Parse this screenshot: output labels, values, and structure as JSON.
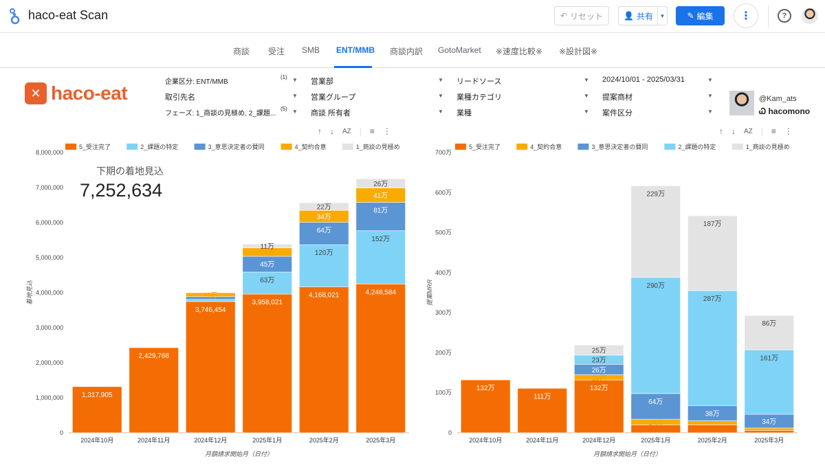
{
  "app": {
    "title": "haco-eat Scan",
    "reset_label": "リセット",
    "share_label": "共有",
    "edit_label": "編集"
  },
  "tabs": [
    {
      "label": "商談"
    },
    {
      "label": "受注"
    },
    {
      "label": "SMB"
    },
    {
      "label": "ENT/MMB",
      "active": true
    },
    {
      "label": "商談内訳"
    },
    {
      "label": "GotoMarket"
    },
    {
      "label": "※速度比較※"
    },
    {
      "label": "※設計図※"
    }
  ],
  "brand": {
    "name": "haco-eat"
  },
  "filters": {
    "row1": [
      {
        "label": "企業区分: ENT/MMB",
        "count": "(1)"
      },
      {
        "label": "営業部"
      },
      {
        "label": "リードソース"
      },
      {
        "label": "2024/10/01 - 2025/03/31"
      }
    ],
    "row2": [
      {
        "label": "取引先名"
      },
      {
        "label": "営業グループ"
      },
      {
        "label": "業種カテゴリ"
      },
      {
        "label": "提案商材"
      }
    ],
    "row3": [
      {
        "label": "フェーズ: 1_商談の見極め, 2_課題...",
        "count": "(5)"
      },
      {
        "label": "商談 所有者"
      },
      {
        "label": "業種"
      },
      {
        "label": "案件区分"
      }
    ]
  },
  "profile": {
    "handle": "@Kam_ats",
    "company": "hacomono"
  },
  "colors": {
    "phase5": "#f46d04",
    "phase4": "#f9ab00",
    "phase3": "#5b95d4",
    "phase2": "#7fd3f7",
    "phase1": "#e3e3e3",
    "accent": "#1a73e8"
  },
  "chart_data": [
    {
      "type": "bar",
      "stacked": true,
      "kpi_label": "下期の着地見込",
      "kpi_value": "7,252,634",
      "xlabel": "月額請求開始月（日付）",
      "ylabel": "着地見込",
      "ylim": [
        0,
        8000000
      ],
      "yticks": [
        "0",
        "1,000,000",
        "2,000,000",
        "3,000,000",
        "4,000,000",
        "5,000,000",
        "6,000,000",
        "7,000,000",
        "8,000,000"
      ],
      "legend_position": "top",
      "categories": [
        "2024年10月",
        "2024年11月",
        "2024年12月",
        "2025年1月",
        "2025年2月",
        "2025年3月"
      ],
      "series": [
        {
          "name": "5_受注完了",
          "color_key": "phase5",
          "values": [
            1317905,
            2429768,
            3746454,
            3958021,
            4168021,
            4248584
          ],
          "labels": [
            "1,317,905",
            "2,429,768",
            "3,746,454",
            "3,958,021",
            "4,168,021",
            "4,248,584"
          ]
        },
        {
          "name": "2_課題の特定",
          "color_key": "phase2",
          "values": [
            0,
            0,
            60000,
            630000,
            1200000,
            1520000
          ],
          "labels": [
            "",
            "",
            "",
            "63万",
            "120万",
            "152万"
          ]
        },
        {
          "name": "3_意思決定者の賛同",
          "color_key": "phase3",
          "values": [
            0,
            0,
            80000,
            450000,
            640000,
            810000
          ],
          "labels": [
            "",
            "",
            "",
            "45万",
            "64万",
            "81万"
          ]
        },
        {
          "name": "4_契約合意",
          "color_key": "phase4",
          "values": [
            0,
            0,
            110000,
            240000,
            340000,
            410000
          ],
          "labels": [
            "",
            "",
            "11万",
            "24万",
            "34万",
            "41万"
          ]
        },
        {
          "name": "1_商談の見極め",
          "color_key": "phase1",
          "values": [
            0,
            0,
            0,
            110000,
            220000,
            260000
          ],
          "labels": [
            "",
            "",
            "",
            "11万",
            "22万",
            "26万"
          ]
        }
      ]
    },
    {
      "type": "bar",
      "stacked": true,
      "xlabel": "月額請求開始月（日付）",
      "ylabel": "提案MRR",
      "ylim": [
        0,
        7000000
      ],
      "yticks": [
        "0",
        "100万",
        "200万",
        "300万",
        "400万",
        "500万",
        "600万",
        "700万"
      ],
      "legend_position": "top",
      "categories": [
        "2024年10月",
        "2024年11月",
        "2024年12月",
        "2025年1月",
        "2025年2月",
        "2025年3月"
      ],
      "series": [
        {
          "name": "5_受注完了",
          "color_key": "phase5",
          "values": [
            1320000,
            1110000,
            1320000,
            200000,
            200000,
            60000
          ],
          "labels": [
            "132万",
            "111万",
            "132万",
            "",
            "",
            ""
          ]
        },
        {
          "name": "4_契約合意",
          "color_key": "phase4",
          "values": [
            0,
            0,
            130000,
            140000,
            100000,
            60000
          ],
          "labels": [
            "",
            "",
            "13万",
            "14万",
            "",
            ""
          ]
        },
        {
          "name": "3_意思決定者の賛同",
          "color_key": "phase3",
          "values": [
            0,
            0,
            260000,
            640000,
            380000,
            340000
          ],
          "labels": [
            "",
            "",
            "26万",
            "64万",
            "38万",
            "34万"
          ]
        },
        {
          "name": "2_課題の特定",
          "color_key": "phase2",
          "values": [
            0,
            0,
            230000,
            2900000,
            2870000,
            1610000
          ],
          "labels": [
            "",
            "",
            "23万",
            "290万",
            "287万",
            "161万"
          ]
        },
        {
          "name": "1_商談の見極め",
          "color_key": "phase1",
          "values": [
            0,
            0,
            250000,
            2290000,
            1870000,
            860000
          ],
          "labels": [
            "",
            "",
            "25万",
            "229万",
            "187万",
            "86万"
          ]
        }
      ]
    }
  ]
}
